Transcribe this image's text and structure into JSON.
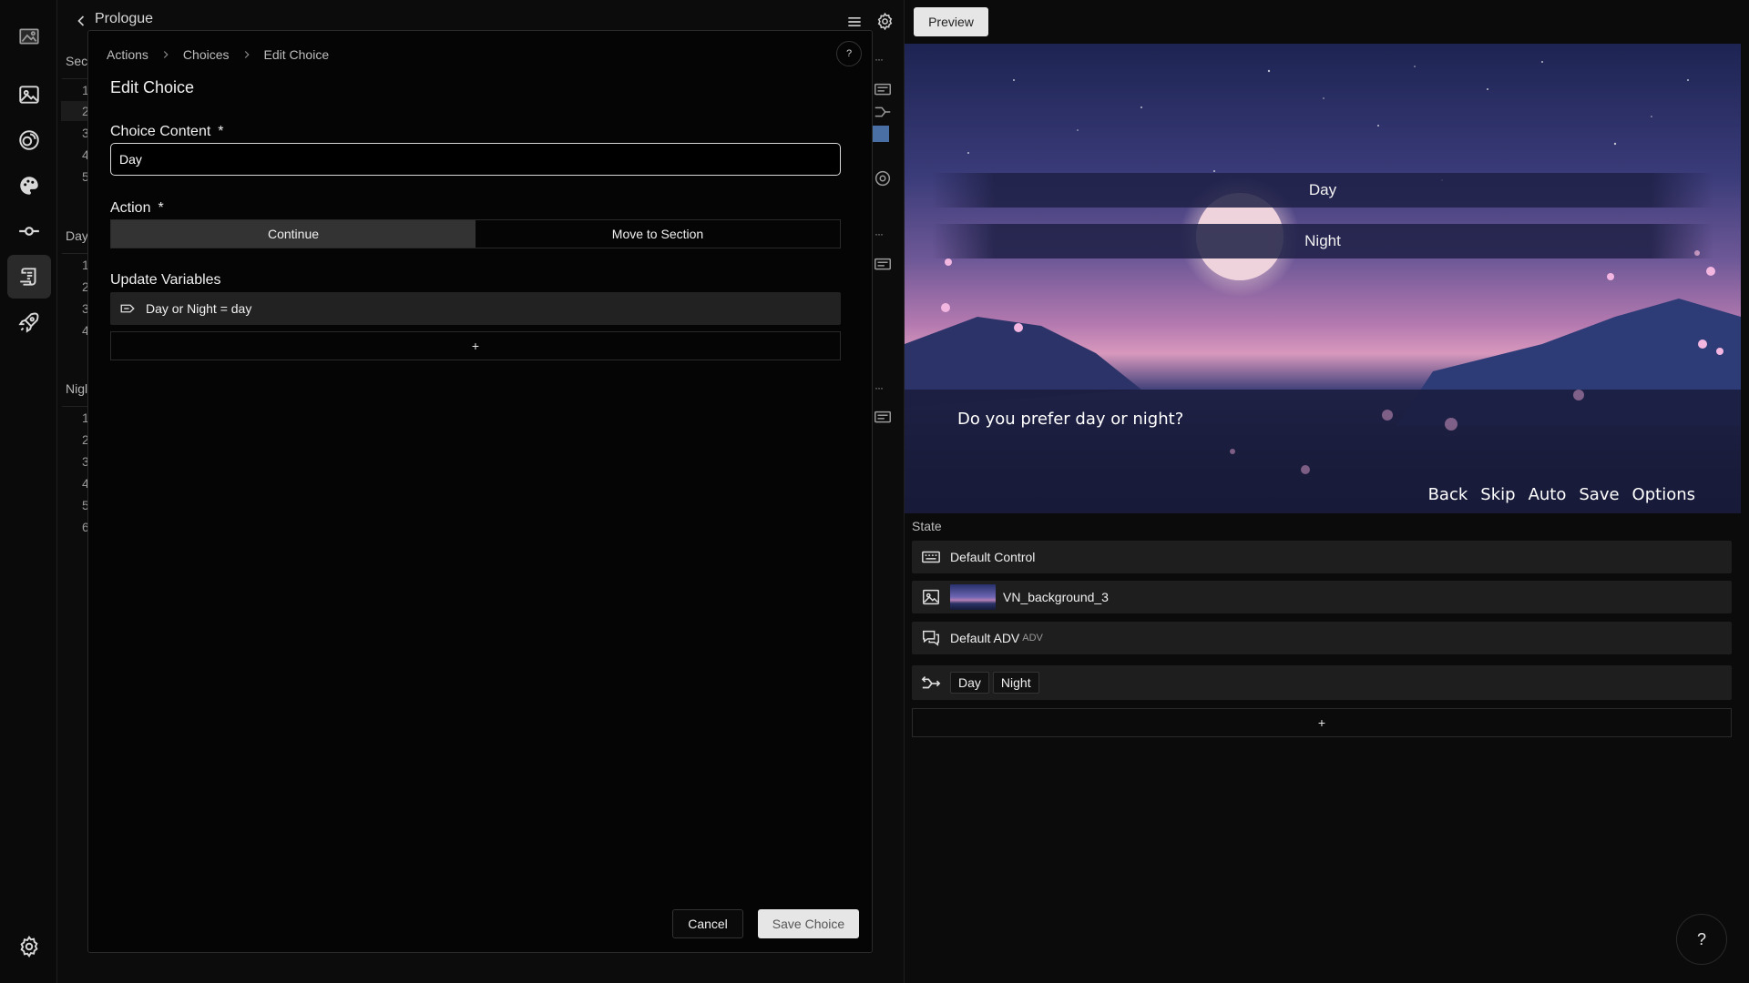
{
  "project": {
    "title": "Prologue",
    "sections": [
      {
        "label": "Sec",
        "items": [
          "1",
          "2",
          "3",
          "4",
          "5"
        ]
      },
      {
        "label": "Day",
        "items": [
          "1",
          "2",
          "3",
          "4"
        ]
      },
      {
        "label": "Nigl",
        "items": [
          "1",
          "2",
          "3",
          "4",
          "5",
          "6"
        ]
      }
    ]
  },
  "modal": {
    "breadcrumb": [
      "Actions",
      "Choices",
      "Edit Choice"
    ],
    "help": "?",
    "title": "Edit Choice",
    "choice_content_label": "Choice Content",
    "required_mark": "*",
    "choice_content_value": "Day",
    "action_label": "Action",
    "action_options": [
      "Continue",
      "Move to Section"
    ],
    "action_selected": "Continue",
    "update_variables_label": "Update Variables",
    "variable_assignment": "Day or Night = day",
    "add_label": "+",
    "cancel_label": "Cancel",
    "save_label": "Save Choice"
  },
  "preview": {
    "button_label": "Preview",
    "choices": [
      "Day",
      "Night"
    ],
    "dialogue": "Do you prefer day or night?",
    "quick_menu": [
      "Back",
      "Skip",
      "Auto",
      "Save",
      "Options"
    ]
  },
  "state": {
    "label": "State",
    "control": "Default Control",
    "background": "VN_background_3",
    "textbox": "Default ADV",
    "textbox_type": "ADV",
    "choice_chips": [
      "Day",
      "Night"
    ],
    "add_label": "+"
  },
  "help_fab": "?",
  "colors": {
    "app_bg": "#0b0b0b",
    "panel_row": "#1e1e1e",
    "selected_toggle": "#333333",
    "primary_button": "#e6e6e6"
  }
}
